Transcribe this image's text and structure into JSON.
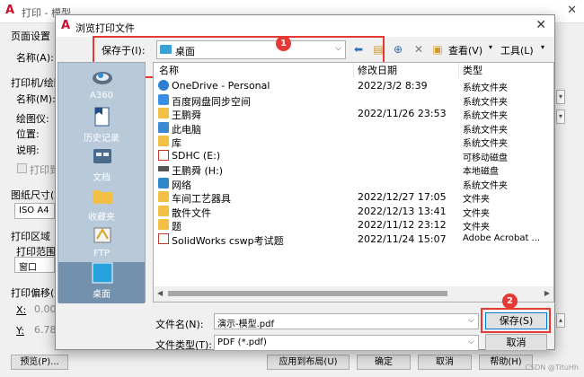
{
  "background": {
    "title": "打印 - 模型",
    "sections": {
      "page_setup": "页面设置",
      "name_label": "名称(A):",
      "printer": "打印机/绘图仪",
      "printer_name": "名称(M):",
      "plotter": "绘图仪:",
      "location": "位置:",
      "description": "说明:",
      "print_to_file": "打印到文件",
      "paper_size": "图纸尺寸(Z)",
      "paper_value": "ISO A4",
      "print_area": "打印区域",
      "print_range": "打印范围(W):",
      "range_value": "窗口",
      "print_offset": "打印偏移(原点设置在可打印区域)",
      "x_label": "X:",
      "x_value": "0.00",
      "y_label": "Y:",
      "y_value": "6.78",
      "preview_btn": "预览(P)...",
      "apply_btn": "应用到布局(U)",
      "ok_btn": "确定",
      "cancel_btn": "取消",
      "help_btn": "帮助(H)"
    }
  },
  "dialog": {
    "title": "浏览打印文件",
    "save_in_label": "保存于(I):",
    "save_in_value": "桌面",
    "toolbar": {
      "view_label": "查看(V)",
      "tools_label": "工具(L)"
    },
    "places": [
      {
        "label": "A360"
      },
      {
        "label": "历史记录"
      },
      {
        "label": "文档"
      },
      {
        "label": "收藏夹"
      },
      {
        "label": "FTP"
      },
      {
        "label": "桌面"
      }
    ],
    "columns": {
      "name": "名称",
      "modified": "修改日期",
      "type": "类型"
    },
    "files": [
      {
        "name": "OneDrive - Personal",
        "date": "2022/3/2 8:39",
        "type": "系统文件夹",
        "icon": "cloud-icon"
      },
      {
        "name": "百度网盘同步空间",
        "date": "",
        "type": "系统文件夹",
        "icon": "baidu-netdisk-icon"
      },
      {
        "name": "王鹏舜",
        "date": "2022/11/26 23:53",
        "type": "系统文件夹",
        "icon": "user-folder-icon"
      },
      {
        "name": "此电脑",
        "date": "",
        "type": "系统文件夹",
        "icon": "computer-icon"
      },
      {
        "name": "库",
        "date": "",
        "type": "系统文件夹",
        "icon": "library-icon"
      },
      {
        "name": "SDHC (E:)",
        "date": "",
        "type": "可移动磁盘",
        "icon": "sd-card-icon"
      },
      {
        "name": "王鹏舜 (H:)",
        "date": "",
        "type": "本地磁盘",
        "icon": "drive-icon"
      },
      {
        "name": "网络",
        "date": "",
        "type": "系统文件夹",
        "icon": "network-icon"
      },
      {
        "name": "车间工艺器具",
        "date": "2022/12/27 17:05",
        "type": "文件夹",
        "icon": "folder-icon"
      },
      {
        "name": "散件文件",
        "date": "2022/12/13 13:41",
        "type": "文件夹",
        "icon": "folder-icon"
      },
      {
        "name": "题",
        "date": "2022/11/12 23:12",
        "type": "文件夹",
        "icon": "folder-icon"
      },
      {
        "name": "SolidWorks cswp考试题",
        "date": "2022/11/24 15:07",
        "type": "Adobe Acrobat ...",
        "icon": "pdf-icon"
      }
    ],
    "filename_label": "文件名(N):",
    "filename_value": "演示-模型.pdf",
    "filetype_label": "文件类型(T):",
    "filetype_value": "PDF (*.pdf)",
    "save_button": "保存(S)",
    "cancel_button": "取消",
    "callouts": [
      "1",
      "2"
    ]
  },
  "watermark": "CSDN @TituHh"
}
